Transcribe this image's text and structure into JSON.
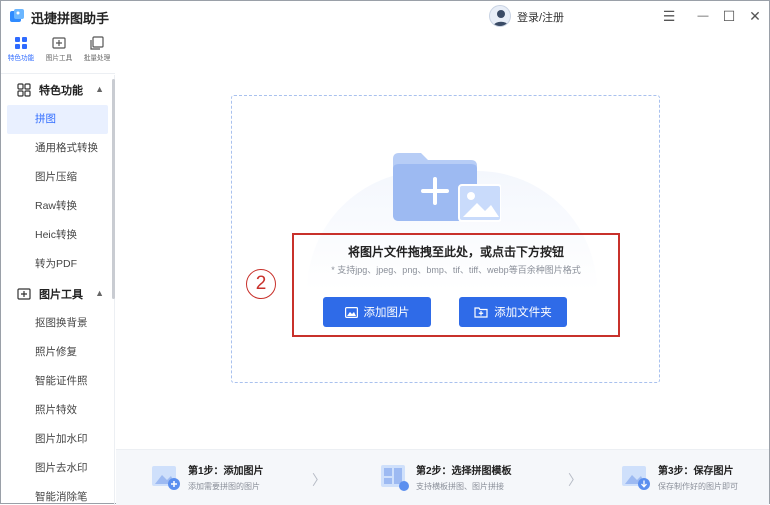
{
  "app": {
    "title": "迅捷拼图助手",
    "login": "登录/注册"
  },
  "window_controls": {
    "menu": "☰",
    "minimize": "—",
    "maximize": "☐",
    "close": "✕"
  },
  "tool_tabs": [
    {
      "label": "特色功能",
      "icon": "grid-icon",
      "active": true
    },
    {
      "label": "图片工具",
      "icon": "image-tool-icon",
      "active": false
    },
    {
      "label": "批量处理",
      "icon": "batch-icon",
      "active": false
    }
  ],
  "sidebar": {
    "groups": [
      {
        "label": "特色功能",
        "icon": "grid-icon",
        "items": [
          "拼图",
          "通用格式转换",
          "图片压缩",
          "Raw转换",
          "Heic转换",
          "转为PDF"
        ]
      },
      {
        "label": "图片工具",
        "icon": "image-icon",
        "items": [
          "抠图换背景",
          "照片修复",
          "智能证件照",
          "照片特效",
          "图片加水印",
          "图片去水印",
          "智能消除笔"
        ]
      }
    ],
    "active_item": "拼图"
  },
  "drop_zone": {
    "title": "将图片文件拖拽至此处，或点击下方按钮",
    "subtitle": "* 支持jpg、jpeg、png、bmp、tif、tiff、webp等百余种图片格式",
    "add_image": "添加图片",
    "add_folder": "添加文件夹",
    "marker": "2"
  },
  "steps": [
    {
      "title": "第1步：添加图片",
      "desc": "添加需要拼图的图片"
    },
    {
      "title": "第2步：选择拼图模板",
      "desc": "支持横板拼图、图片拼接"
    },
    {
      "title": "第3步：保存图片",
      "desc": "保存制作好的图片即可"
    }
  ],
  "colors": {
    "accent": "#2f6be8",
    "highlight": "#c8312b",
    "active_bg": "#e9f0ff"
  }
}
